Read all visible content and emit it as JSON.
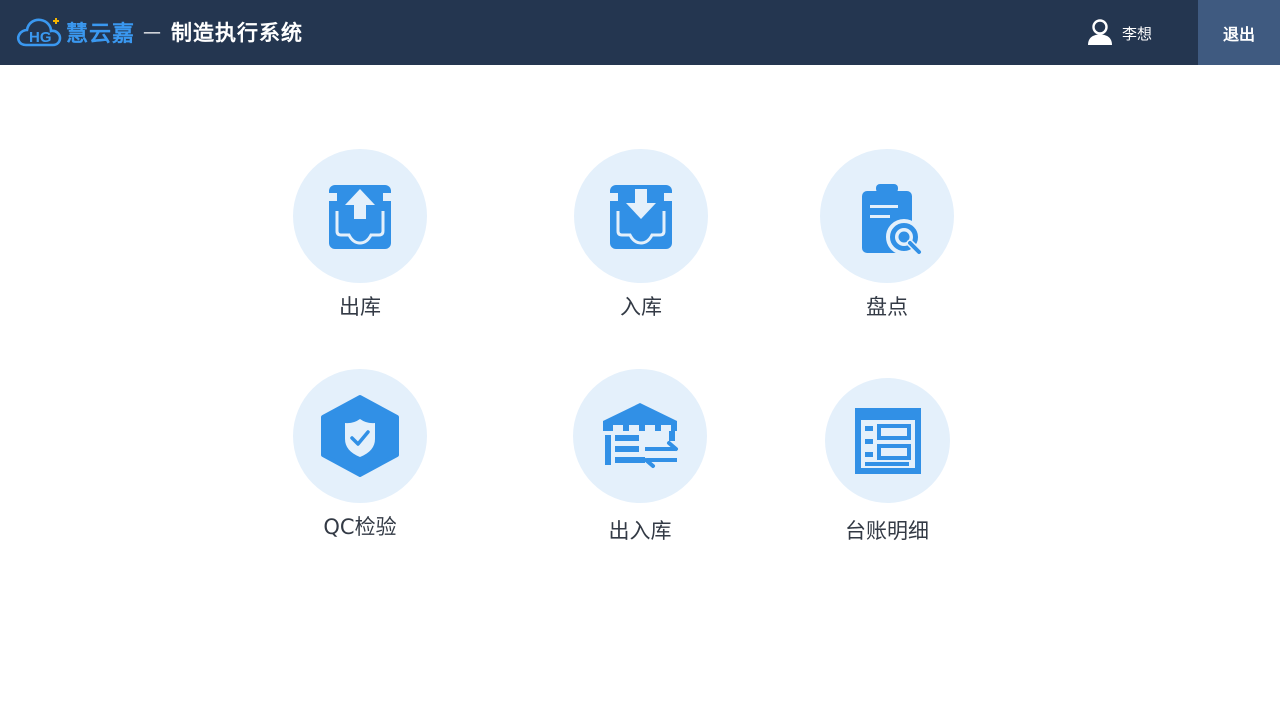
{
  "header": {
    "brand_name": "慧云嘉",
    "separator": "—",
    "system_name": "制造执行系统",
    "user_name": "李想",
    "logout_label": "退出",
    "icons": {
      "logo": "cloud-hg-logo-icon",
      "user": "user-icon"
    }
  },
  "menu": {
    "items": [
      {
        "label": "出库",
        "icon": "outbound-tray-icon"
      },
      {
        "label": "入库",
        "icon": "inbound-tray-icon"
      },
      {
        "label": "盘点",
        "icon": "clipboard-search-icon"
      },
      {
        "label": "QC检验",
        "icon": "shield-check-icon"
      },
      {
        "label": "出入库",
        "icon": "warehouse-transfer-icon"
      },
      {
        "label": "台账明细",
        "icon": "ledger-list-icon"
      }
    ]
  },
  "colors": {
    "header_bg": "#243650",
    "logout_bg": "#3f5a80",
    "accent": "#3190e6",
    "circle_bg": "#e4f0fb",
    "label_text": "#333a45"
  }
}
